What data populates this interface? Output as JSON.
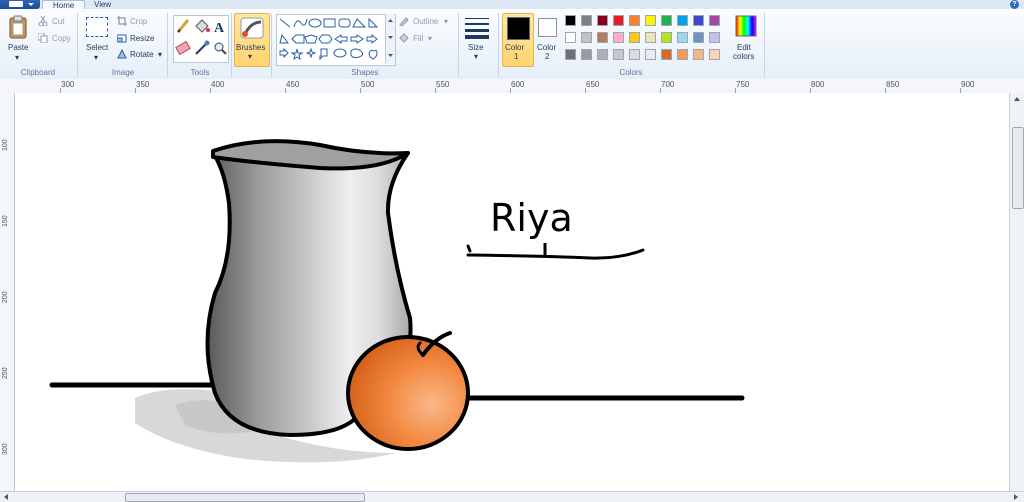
{
  "tabs": {
    "home": "Home",
    "view": "View"
  },
  "help_icon": "?",
  "clipboard": {
    "paste": "Paste",
    "cut": "Cut",
    "copy": "Copy",
    "group": "Clipboard"
  },
  "image": {
    "select": "Select",
    "crop": "Crop",
    "resize": "Resize",
    "rotate": "Rotate",
    "group": "Image"
  },
  "tools": {
    "group": "Tools"
  },
  "brushes": {
    "label": "Brushes"
  },
  "shapes": {
    "outline": "Outline",
    "fill": "Fill",
    "group": "Shapes"
  },
  "size": {
    "label": "Size"
  },
  "colors": {
    "color1": "Color",
    "color1_num": "1",
    "color2": "Color",
    "color2_num": "2",
    "edit": "Edit",
    "edit2": "colors",
    "group": "Colors",
    "palette_row1": [
      "#000000",
      "#7f7f7f",
      "#880015",
      "#ed1c24",
      "#ff7f27",
      "#fff200",
      "#22b14c",
      "#00a2e8",
      "#3f48cc",
      "#a349a4"
    ],
    "palette_row2": [
      "#ffffff",
      "#c3c3c3",
      "#b97a57",
      "#ffaec9",
      "#ffc90e",
      "#efe4b0",
      "#b5e61d",
      "#99d9ea",
      "#7092be",
      "#c8bfe7"
    ],
    "palette_row3": [
      "#707070",
      "#9a9a9a",
      "#b0b0b0",
      "#c8c8c8",
      "#dcdcdc",
      "#ececec",
      "#d86b1e",
      "#f49b58",
      "#f7b485",
      "#fbd3b3"
    ]
  },
  "ruler_top": [
    "300",
    "350",
    "400",
    "450",
    "500",
    "550",
    "600",
    "650",
    "700",
    "750",
    "800",
    "850",
    "900"
  ],
  "ruler_left": [
    "100",
    "150",
    "200",
    "250",
    "300"
  ],
  "drawing": {
    "signature": "Riya"
  }
}
